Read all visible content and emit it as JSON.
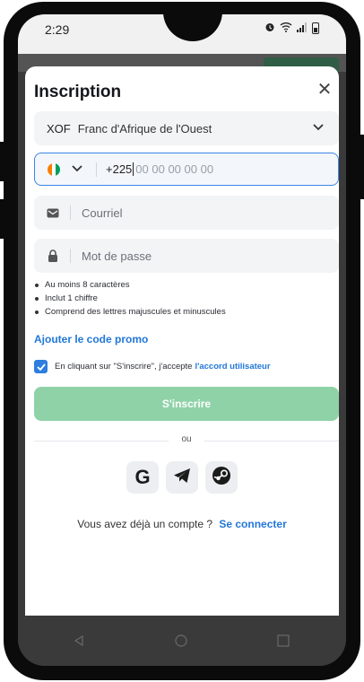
{
  "status_bar": {
    "time": "2:29"
  },
  "modal": {
    "title": "Inscription",
    "currency": {
      "code": "XOF",
      "name": "Franc d'Afrique de l'Ouest"
    },
    "phone": {
      "prefix": "+225",
      "placeholder": "00 00 00 00 00"
    },
    "email": {
      "placeholder": "Courriel"
    },
    "password": {
      "placeholder": "Mot de passe"
    },
    "rules": [
      "Au moins 8 caractères",
      "Inclut 1 chiffre",
      "Comprend des lettres majuscules et minuscules"
    ],
    "promo_link": "Ajouter le code promo",
    "terms": {
      "checked": true,
      "text": "En cliquant sur \"S'inscrire\", j'accepte",
      "link": "l'accord utilisateur"
    },
    "signup_button": "S'inscrire",
    "or_label": "ou",
    "socials": [
      "google-icon",
      "telegram-icon",
      "steam-icon"
    ],
    "login": {
      "text": "Vous avez déjà un compte ?",
      "link": "Se connecter"
    }
  },
  "colors": {
    "accent": "#2277d8",
    "signup_button": "#8fd2a8",
    "field_bg": "#f3f4f6",
    "focus_border": "#3b86e6",
    "flag": [
      "#f77f00",
      "#ffffff",
      "#009e60"
    ]
  }
}
